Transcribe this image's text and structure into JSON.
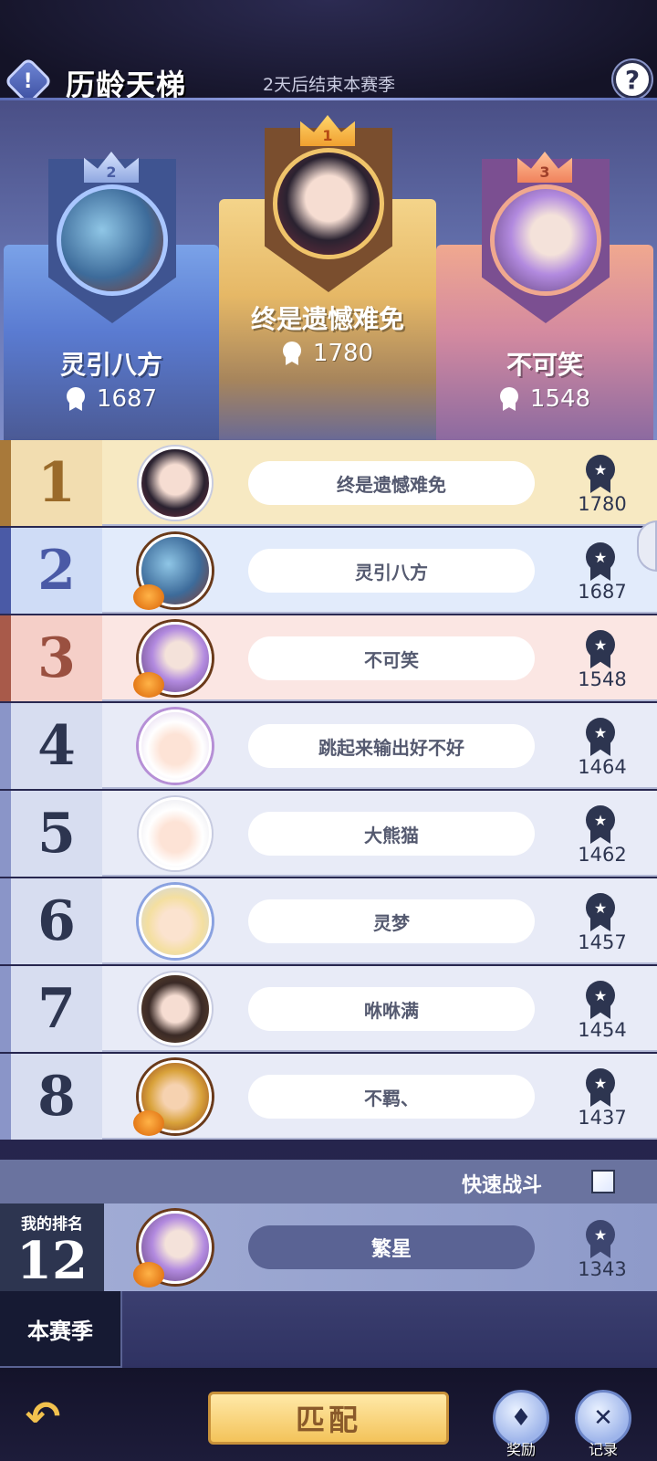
{
  "header": {
    "title": "历龄天梯",
    "subtitle": "2天后结束本赛季",
    "info_symbol": "!",
    "help_symbol": "?"
  },
  "podium": [
    {
      "place": "2",
      "name": "灵引八方",
      "score": "1687"
    },
    {
      "place": "1",
      "name": "终是遗憾难免",
      "score": "1780"
    },
    {
      "place": "3",
      "name": "不可笑",
      "score": "1548"
    }
  ],
  "leaderboard": [
    {
      "rank": "1",
      "name": "终是遗憾难免",
      "score": "1780"
    },
    {
      "rank": "2",
      "name": "灵引八方",
      "score": "1687"
    },
    {
      "rank": "3",
      "name": "不可笑",
      "score": "1548"
    },
    {
      "rank": "4",
      "name": "跳起来输出好不好",
      "score": "1464"
    },
    {
      "rank": "5",
      "name": "大熊猫",
      "score": "1462"
    },
    {
      "rank": "6",
      "name": "灵梦",
      "score": "1457"
    },
    {
      "rank": "7",
      "name": "咻咻满",
      "score": "1454"
    },
    {
      "rank": "8",
      "name": "不羁、",
      "score": "1437"
    }
  ],
  "quick_battle": {
    "label": "快速战斗"
  },
  "my_rank": {
    "label": "我的排名",
    "rank": "12",
    "name": "繁星",
    "score": "1343"
  },
  "season_tab": "本赛季",
  "bottom": {
    "match_label": "匹配",
    "reward_label": "奖励",
    "record_label": "记录"
  },
  "colors": {
    "rank1": "#f7e9c2",
    "rank2": "#e2ebfb",
    "rank3": "#fbe6e3",
    "rank_other": "#e8ebf7",
    "accent_gold": "#f3c35a",
    "text_dark": "#2d3550"
  }
}
